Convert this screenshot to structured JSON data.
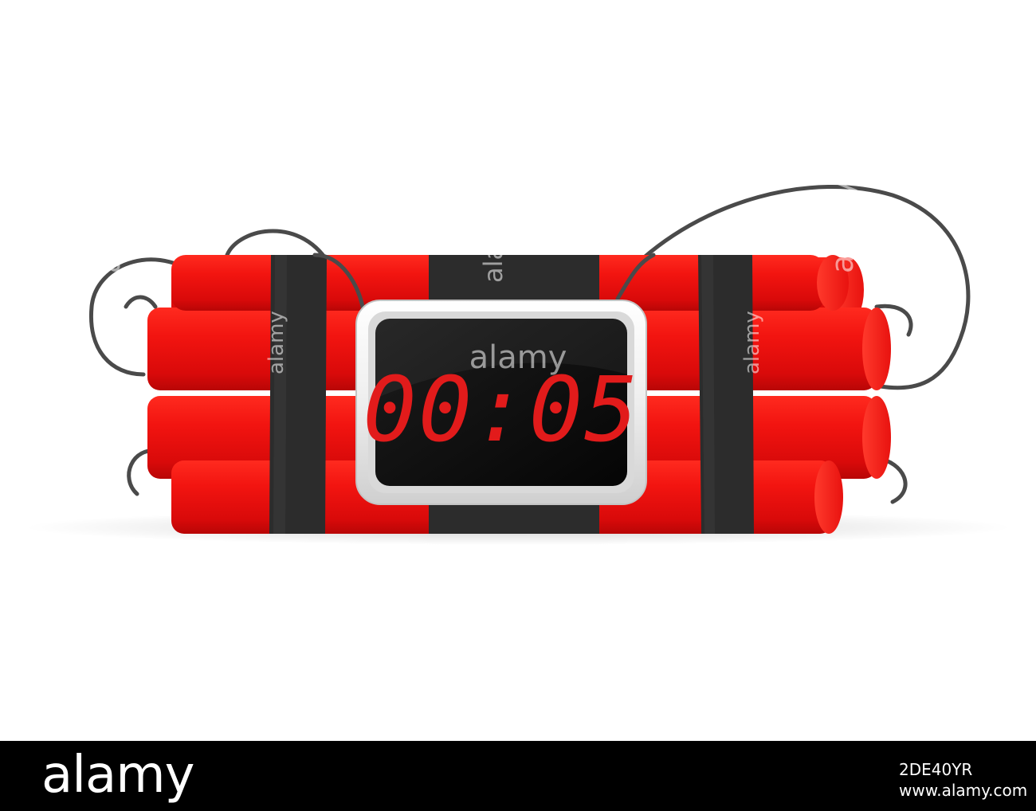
{
  "timer": {
    "display": "00:05"
  },
  "watermark": {
    "text": "alamy"
  },
  "footer": {
    "brand": "alamy",
    "image_id": "2DE40YR",
    "url": "www.alamy.com"
  },
  "colors": {
    "dynamite": "#ee0d0d",
    "band": "#2c2c2c",
    "screen": "#0d0d0d",
    "digits": "#e21b1b",
    "frame": "#f2f2f2",
    "wire": "#4a4a4a"
  }
}
